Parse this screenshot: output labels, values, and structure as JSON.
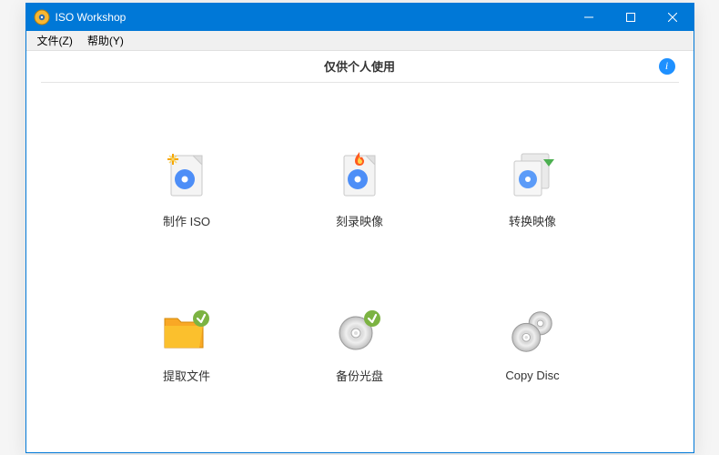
{
  "window": {
    "title": "ISO Workshop"
  },
  "menu": {
    "file": "文件(Z)",
    "help": "帮助(Y)"
  },
  "header": {
    "notice": "仅供个人使用"
  },
  "tiles": {
    "make_iso": "制作 ISO",
    "burn_image": "刻录映像",
    "convert_image": "转换映像",
    "extract_files": "提取文件",
    "backup_disc": "备份光盘",
    "copy_disc": "Copy Disc"
  }
}
